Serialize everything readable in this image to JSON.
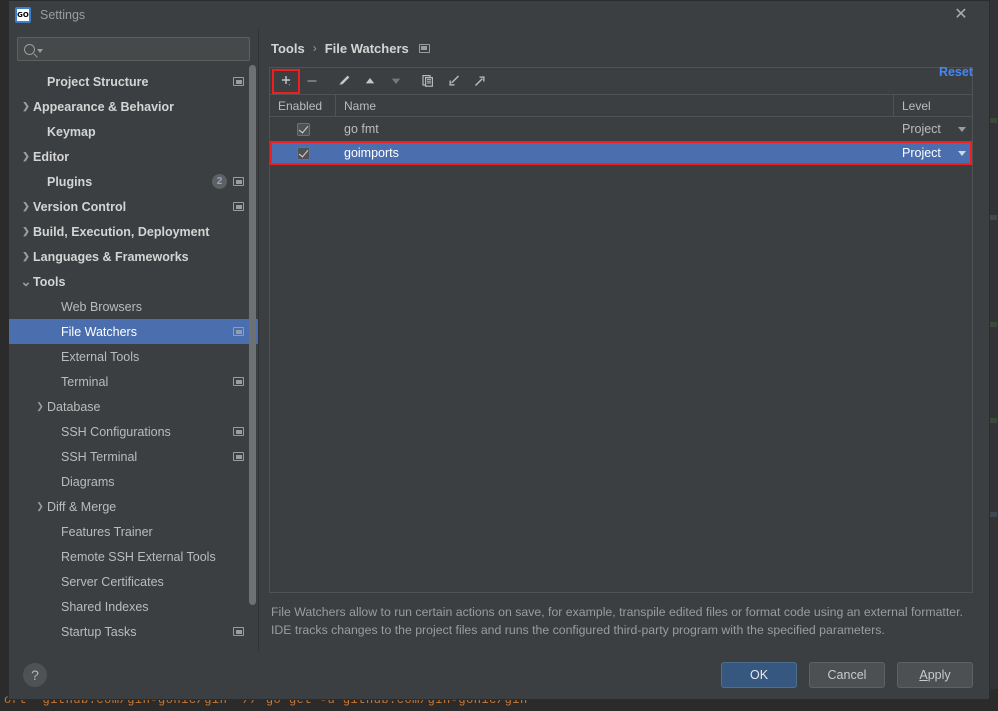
{
  "window": {
    "title": "Settings",
    "app_icon": "go-logo-icon",
    "close_icon": "close-icon"
  },
  "search": {
    "value": "",
    "placeholder": "",
    "icon": "search-icon"
  },
  "sidebar": {
    "items": [
      {
        "label": "Project Structure",
        "indent": 1,
        "arrow": "",
        "bold": true,
        "badge": "",
        "mod": true,
        "selected": false
      },
      {
        "label": "Appearance & Behavior",
        "indent": 0,
        "arrow": "›",
        "bold": true,
        "badge": "",
        "mod": false,
        "selected": false
      },
      {
        "label": "Keymap",
        "indent": 1,
        "arrow": "",
        "bold": true,
        "badge": "",
        "mod": false,
        "selected": false
      },
      {
        "label": "Editor",
        "indent": 0,
        "arrow": "›",
        "bold": true,
        "badge": "",
        "mod": false,
        "selected": false
      },
      {
        "label": "Plugins",
        "indent": 1,
        "arrow": "",
        "bold": true,
        "badge": "2",
        "mod": true,
        "selected": false
      },
      {
        "label": "Version Control",
        "indent": 0,
        "arrow": "›",
        "bold": true,
        "badge": "",
        "mod": true,
        "selected": false
      },
      {
        "label": "Build, Execution, Deployment",
        "indent": 0,
        "arrow": "›",
        "bold": true,
        "badge": "",
        "mod": false,
        "selected": false
      },
      {
        "label": "Languages & Frameworks",
        "indent": 0,
        "arrow": "›",
        "bold": true,
        "badge": "",
        "mod": false,
        "selected": false
      },
      {
        "label": "Tools",
        "indent": 0,
        "arrow": "⌄",
        "bold": true,
        "badge": "",
        "mod": false,
        "selected": false
      },
      {
        "label": "Web Browsers",
        "indent": 2,
        "arrow": "",
        "bold": false,
        "badge": "",
        "mod": false,
        "selected": false
      },
      {
        "label": "File Watchers",
        "indent": 2,
        "arrow": "",
        "bold": false,
        "badge": "",
        "mod": true,
        "selected": true
      },
      {
        "label": "External Tools",
        "indent": 2,
        "arrow": "",
        "bold": false,
        "badge": "",
        "mod": false,
        "selected": false
      },
      {
        "label": "Terminal",
        "indent": 2,
        "arrow": "",
        "bold": false,
        "badge": "",
        "mod": true,
        "selected": false
      },
      {
        "label": "Database",
        "indent": 1,
        "arrow": "›",
        "bold": false,
        "badge": "",
        "mod": false,
        "selected": false
      },
      {
        "label": "SSH Configurations",
        "indent": 2,
        "arrow": "",
        "bold": false,
        "badge": "",
        "mod": true,
        "selected": false
      },
      {
        "label": "SSH Terminal",
        "indent": 2,
        "arrow": "",
        "bold": false,
        "badge": "",
        "mod": true,
        "selected": false
      },
      {
        "label": "Diagrams",
        "indent": 2,
        "arrow": "",
        "bold": false,
        "badge": "",
        "mod": false,
        "selected": false
      },
      {
        "label": "Diff & Merge",
        "indent": 1,
        "arrow": "›",
        "bold": false,
        "badge": "",
        "mod": false,
        "selected": false
      },
      {
        "label": "Features Trainer",
        "indent": 2,
        "arrow": "",
        "bold": false,
        "badge": "",
        "mod": false,
        "selected": false
      },
      {
        "label": "Remote SSH External Tools",
        "indent": 2,
        "arrow": "",
        "bold": false,
        "badge": "",
        "mod": false,
        "selected": false
      },
      {
        "label": "Server Certificates",
        "indent": 2,
        "arrow": "",
        "bold": false,
        "badge": "",
        "mod": false,
        "selected": false
      },
      {
        "label": "Shared Indexes",
        "indent": 2,
        "arrow": "",
        "bold": false,
        "badge": "",
        "mod": false,
        "selected": false
      },
      {
        "label": "Startup Tasks",
        "indent": 2,
        "arrow": "",
        "bold": false,
        "badge": "",
        "mod": true,
        "selected": false
      }
    ]
  },
  "content": {
    "breadcrumb": {
      "parent": "Tools",
      "separator": "›",
      "current": "File Watchers",
      "mod_icon": "modified-marker-icon"
    },
    "reset_label": "Reset",
    "toolbar": [
      {
        "name": "add-button",
        "icon": "plus-icon",
        "highlighted": true
      },
      {
        "name": "remove-button",
        "icon": "minus-icon",
        "highlighted": false
      },
      {
        "name": "edit-button",
        "icon": "pencil-icon",
        "highlighted": false
      },
      {
        "name": "move-up-button",
        "icon": "arrow-up-icon",
        "highlighted": false
      },
      {
        "name": "move-down-button",
        "icon": "arrow-down-icon",
        "highlighted": false
      },
      {
        "name": "copy-button",
        "icon": "copy-icon",
        "highlighted": false
      },
      {
        "name": "import-button",
        "icon": "import-arrow-icon",
        "highlighted": false
      },
      {
        "name": "export-button",
        "icon": "export-arrow-icon",
        "highlighted": false
      }
    ],
    "table": {
      "columns": [
        "Enabled",
        "Name",
        "Level"
      ],
      "rows": [
        {
          "enabled": true,
          "name": "go fmt",
          "level": "Project",
          "selected": false,
          "outlined": false
        },
        {
          "enabled": true,
          "name": "goimports",
          "level": "Project",
          "selected": true,
          "outlined": true
        }
      ]
    },
    "description": "File Watchers allow to run certain actions on save, for example, transpile edited files or format code using an external formatter. IDE tracks changes to the project files and runs the configured third-party program with the specified parameters."
  },
  "footer": {
    "help_label": "?",
    "ok_label": "OK",
    "cancel_label": "Cancel",
    "apply_label_prefix": "A",
    "apply_label_rest": "pply"
  },
  "background": {
    "code_line": "ort \"github.com/gin-gonic/gin\"   // go get -u github.com/gin-gonic/gin"
  },
  "colors": {
    "accent_selection": "#4b6eaf",
    "highlight_red": "#f01e1e",
    "link_blue": "#4887f2",
    "dialog_bg": "#3c3f41",
    "primary_button": "#365880"
  }
}
